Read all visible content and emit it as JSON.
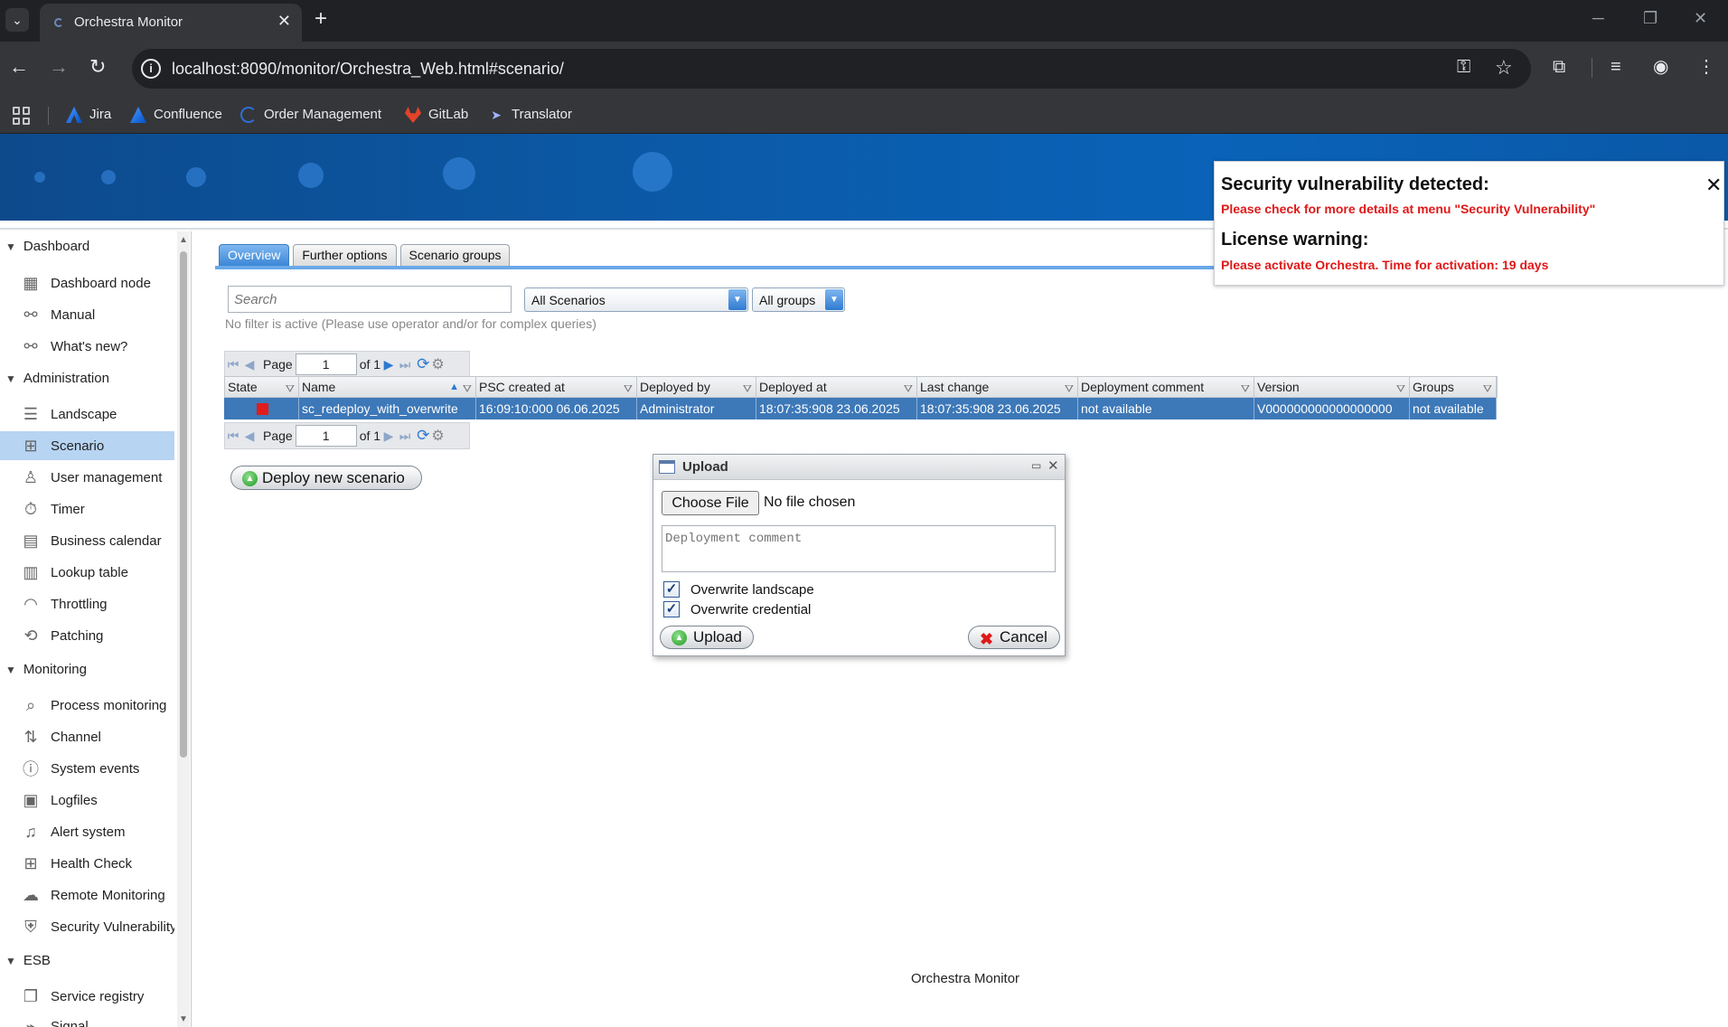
{
  "browser": {
    "tab_title": "Orchestra Monitor",
    "url": "localhost:8090/monitor/Orchestra_Web.html#scenario/",
    "bookmarks": [
      {
        "label": "Jira",
        "icon": "jira-icon"
      },
      {
        "label": "Confluence",
        "icon": "confluence-icon"
      },
      {
        "label": "Order Management",
        "icon": "order-management-icon"
      },
      {
        "label": "GitLab",
        "icon": "gitlab-icon"
      },
      {
        "label": "Translator",
        "icon": "translator-icon"
      }
    ]
  },
  "sidebar": {
    "groups": [
      {
        "label": "Dashboard",
        "items": [
          {
            "label": "Dashboard node",
            "icon": "dashboard-grid-icon"
          },
          {
            "label": "Manual",
            "icon": "nodes-icon"
          },
          {
            "label": "What's new?",
            "icon": "nodes-icon"
          }
        ]
      },
      {
        "label": "Administration",
        "items": [
          {
            "label": "Landscape",
            "icon": "sliders-icon"
          },
          {
            "label": "Scenario",
            "icon": "scenario-icon",
            "selected": true
          },
          {
            "label": "User management",
            "icon": "user-icon"
          },
          {
            "label": "Timer",
            "icon": "timer-icon"
          },
          {
            "label": "Business calendar",
            "icon": "calendar-icon"
          },
          {
            "label": "Lookup table",
            "icon": "table-icon"
          },
          {
            "label": "Throttling",
            "icon": "gauge-icon"
          },
          {
            "label": "Patching",
            "icon": "patch-icon"
          }
        ]
      },
      {
        "label": "Monitoring",
        "items": [
          {
            "label": "Process monitoring",
            "icon": "magnifier-icon"
          },
          {
            "label": "Channel",
            "icon": "channel-icon"
          },
          {
            "label": "System events",
            "icon": "info-icon"
          },
          {
            "label": "Logfiles",
            "icon": "log-icon"
          },
          {
            "label": "Alert system",
            "icon": "bell-icon"
          },
          {
            "label": "Health Check",
            "icon": "health-icon"
          },
          {
            "label": "Remote Monitoring",
            "icon": "cloud-icon"
          },
          {
            "label": "Security Vulnerability",
            "icon": "shield-icon"
          }
        ]
      },
      {
        "label": "ESB",
        "items": [
          {
            "label": "Service registry",
            "icon": "registry-icon"
          },
          {
            "label": "Signal",
            "icon": "signal-icon"
          }
        ]
      }
    ]
  },
  "main": {
    "tabs": [
      {
        "label": "Overview",
        "active": true
      },
      {
        "label": "Further options"
      },
      {
        "label": "Scenario groups"
      }
    ],
    "search_placeholder": "Search",
    "scenario_filter": "All Scenarios",
    "group_filter": "All groups",
    "filter_note": "No filter is active (Please use operator and/or for complex queries)",
    "pager": {
      "page_label": "Page",
      "page_value": "1",
      "of_label": "of 1"
    },
    "grid": {
      "columns": [
        "State",
        "Name",
        "PSC created at",
        "Deployed by",
        "Deployed at",
        "Last change",
        "Deployment comment",
        "Version",
        "Groups"
      ],
      "rows": [
        {
          "state": "stopped",
          "state_color": "#e31b1b",
          "name": "sc_redeploy_with_overwrite",
          "psc_created_at": "16:09:10:000 06.06.2025",
          "deployed_by": "Administrator",
          "deployed_at": "18:07:35:908 23.06.2025",
          "last_change": "18:07:35:908 23.06.2025",
          "deployment_comment": "not available",
          "version": "V000000000000000000",
          "groups": "not available"
        }
      ]
    },
    "deploy_button": "Deploy new scenario",
    "footer": "Orchestra Monitor"
  },
  "upload_dialog": {
    "title": "Upload",
    "choose_file": "Choose File",
    "no_file": "No file chosen",
    "comment_placeholder": "Deployment comment",
    "overwrite_landscape": "Overwrite landscape",
    "overwrite_credential": "Overwrite credential",
    "upload_button": "Upload",
    "cancel_button": "Cancel"
  },
  "notification": {
    "security_title": "Security vulnerability detected:",
    "security_message": "Please check for more details at menu \"Security Vulnerability\"",
    "license_title": "License warning:",
    "license_message": "Please activate Orchestra. Time for activation: 19 days"
  },
  "colors": {
    "accent": "#3d78b8",
    "banner": "#0b5aa8",
    "error": "#e01818",
    "selected_nav": "#b7d4f3"
  }
}
